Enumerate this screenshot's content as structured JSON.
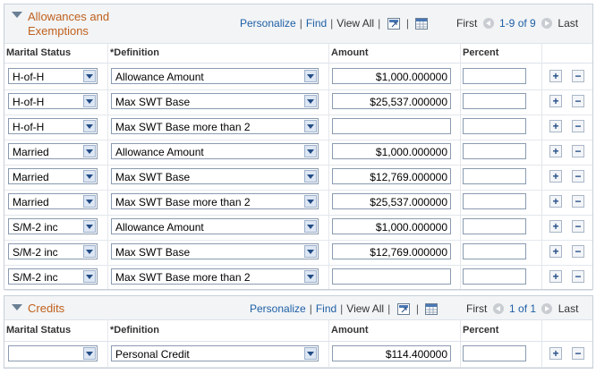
{
  "allowances": {
    "title_line1": "Allowances and",
    "title_line2": "Exemptions",
    "toolbar": {
      "personalize": "Personalize",
      "find": "Find",
      "view_all": "View All"
    },
    "nav": {
      "first": "First",
      "range": "1-9 of 9",
      "last": "Last"
    },
    "columns": {
      "marital_status": "Marital Status",
      "definition": "*Definition",
      "amount": "Amount",
      "percent": "Percent"
    },
    "rows": [
      {
        "status": "H-of-H",
        "definition": "Allowance Amount",
        "amount": "$1,000.000000",
        "percent": ""
      },
      {
        "status": "H-of-H",
        "definition": "Max SWT Base",
        "amount": "$25,537.000000",
        "percent": ""
      },
      {
        "status": "H-of-H",
        "definition": "Max SWT Base more than 2",
        "amount": "",
        "percent": ""
      },
      {
        "status": "Married",
        "definition": "Allowance Amount",
        "amount": "$1,000.000000",
        "percent": ""
      },
      {
        "status": "Married",
        "definition": "Max SWT Base",
        "amount": "$12,769.000000",
        "percent": ""
      },
      {
        "status": "Married",
        "definition": "Max SWT Base more than 2",
        "amount": "$25,537.000000",
        "percent": ""
      },
      {
        "status": "S/M-2 inc",
        "definition": "Allowance Amount",
        "amount": "$1,000.000000",
        "percent": ""
      },
      {
        "status": "S/M-2 inc",
        "definition": "Max SWT Base",
        "amount": "$12,769.000000",
        "percent": ""
      },
      {
        "status": "S/M-2 inc",
        "definition": "Max SWT Base more than 2",
        "amount": "",
        "percent": ""
      }
    ]
  },
  "credits": {
    "title": "Credits",
    "toolbar": {
      "personalize": "Personalize",
      "find": "Find",
      "view_all": "View All"
    },
    "nav": {
      "first": "First",
      "range": "1 of 1",
      "last": "Last"
    },
    "columns": {
      "marital_status": "Marital Status",
      "definition": "*Definition",
      "amount": "Amount",
      "percent": "Percent"
    },
    "rows": [
      {
        "status": "",
        "definition": "Personal Credit",
        "amount": "$114.400000",
        "percent": ""
      }
    ]
  },
  "row_buttons": {
    "add": "+",
    "delete": "−"
  },
  "icons": {
    "zoom": "zoom-grid-icon",
    "download": "download-spreadsheet-icon"
  },
  "colors": {
    "title": "#c0601c",
    "link": "#1f5fa5",
    "header_bg": "#f2f4f6"
  }
}
